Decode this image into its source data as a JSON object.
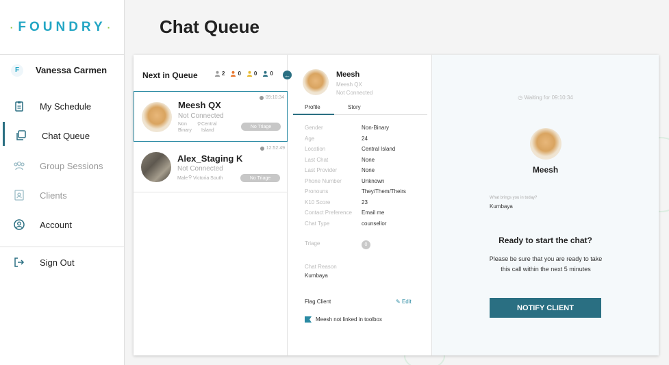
{
  "brand": "FOUNDRY",
  "user": {
    "name": "Vanessa Carmen",
    "logo_letter": "F"
  },
  "nav": [
    {
      "label": "My Schedule",
      "icon": "clipboard-icon",
      "state": "normal"
    },
    {
      "label": "Chat Queue",
      "icon": "chat-queue-icon",
      "state": "active"
    },
    {
      "label": "Group Sessions",
      "icon": "group-icon",
      "state": "dim"
    },
    {
      "label": "Clients",
      "icon": "contact-card-icon",
      "state": "dim"
    },
    {
      "label": "Account",
      "icon": "account-icon",
      "state": "normal"
    }
  ],
  "signout": {
    "label": "Sign Out",
    "icon": "sign-out-icon"
  },
  "page_title": "Chat Queue",
  "queue": {
    "title": "Next in Queue",
    "counts": [
      {
        "value": "2",
        "color": "#999999"
      },
      {
        "value": "0",
        "color": "#e8772e"
      },
      {
        "value": "0",
        "color": "#e8b92e"
      },
      {
        "value": "0",
        "color": "#2a6f82"
      }
    ],
    "items": [
      {
        "name": "Meesh QX",
        "status": "Not Connected",
        "gender": "Non Binary",
        "location": "Central Island",
        "time": "09:10:34",
        "triage": "No Triage"
      },
      {
        "name": "Alex_Staging K",
        "status": "Not Connected",
        "gender": "Male",
        "location": "Victoria South",
        "time": "12:52:49",
        "triage": "No Triage"
      }
    ]
  },
  "profile": {
    "name": "Meesh",
    "sub1": "Meesh QX",
    "sub2": "Not Connected",
    "tabs": [
      "Profile",
      "Story"
    ],
    "fields": [
      {
        "label": "Gender",
        "value": "Non-Binary"
      },
      {
        "label": "Age",
        "value": "24"
      },
      {
        "label": "Location",
        "value": "Central Island"
      },
      {
        "label": "Last Chat",
        "value": "None"
      },
      {
        "label": "Last Provider",
        "value": "None"
      },
      {
        "label": "Phone Number",
        "value": "Unknown"
      },
      {
        "label": "Pronouns",
        "value": "They/Them/Theirs"
      },
      {
        "label": "K10 Score",
        "value": "23"
      },
      {
        "label": "Contact Preference",
        "value": "Email me"
      },
      {
        "label": "Chat Type",
        "value": "counsellor"
      }
    ],
    "triage_label": "Triage",
    "triage_value": "0",
    "chat_reason_label": "Chat Reason",
    "chat_reason_value": "Kumbaya",
    "flag_label": "Flag Client",
    "edit_label": "Edit",
    "toolbox_text": "Meesh not linked in toolbox"
  },
  "right": {
    "waiting": "Waiting for 09:10:34",
    "name": "Meesh",
    "question": "What brings you in today?",
    "answer": "Kumbaya",
    "ready_title": "Ready to start the chat?",
    "ready_desc": "Please be sure that you are ready to take this call within the next 5 minutes",
    "notify_label": "NOTIFY CLIENT"
  },
  "colors": {
    "accent": "#2a6f82",
    "brand": "#23a6c4"
  }
}
